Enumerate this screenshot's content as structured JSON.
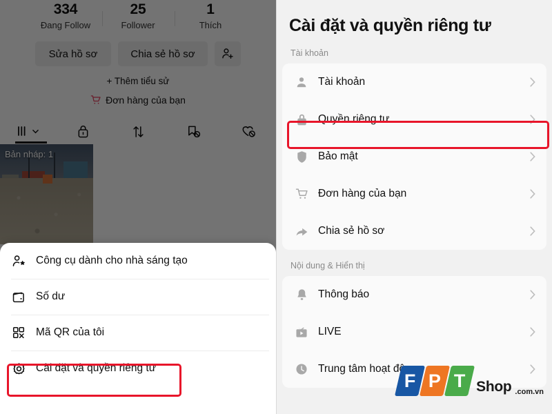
{
  "left_panel": {
    "stats": [
      {
        "value": "334",
        "label": "Đang Follow"
      },
      {
        "value": "25",
        "label": "Follower"
      },
      {
        "value": "1",
        "label": "Thích"
      }
    ],
    "buttons": {
      "edit_profile": "Sửa hồ sơ",
      "share_profile": "Chia sẻ hồ sơ",
      "add_friend_icon": "person-add-icon"
    },
    "add_bio": "+ Thêm tiểu sử",
    "orders_link": "Đơn hàng của bạn",
    "tabs": [
      {
        "icon": "grid-dropdown-icon",
        "name": "tab-posts"
      },
      {
        "icon": "lock-icon",
        "name": "tab-private"
      },
      {
        "icon": "repost-arrows-icon",
        "name": "tab-repost"
      },
      {
        "icon": "bookmark-hidden-icon",
        "name": "tab-saved"
      },
      {
        "icon": "heart-hidden-icon",
        "name": "tab-liked"
      }
    ],
    "draft_badge": "Bản nháp: 1",
    "sheet_items": [
      {
        "icon": "person-star-icon",
        "label": "Công cụ dành cho nhà sáng tạo"
      },
      {
        "icon": "wallet-icon",
        "label": "Số dư"
      },
      {
        "icon": "qr-code-icon",
        "label": "Mã QR của tôi"
      },
      {
        "icon": "gear-icon",
        "label": "Cài đặt và quyền riêng tư"
      }
    ]
  },
  "right_panel": {
    "title": "Cài đặt và quyền riêng tư",
    "sections": [
      {
        "header": "Tài khoản",
        "items": [
          {
            "icon": "person-icon",
            "label": "Tài khoản"
          },
          {
            "icon": "lock-icon",
            "label": "Quyền riêng tư"
          },
          {
            "icon": "shield-icon",
            "label": "Bảo mật"
          },
          {
            "icon": "cart-icon",
            "label": "Đơn hàng của bạn"
          },
          {
            "icon": "share-arrow-icon",
            "label": "Chia sẻ hồ sơ"
          }
        ]
      },
      {
        "header": "Nội dung & Hiển thị",
        "items": [
          {
            "icon": "bell-icon",
            "label": "Thông báo"
          },
          {
            "icon": "live-tv-icon",
            "label": "LIVE"
          },
          {
            "icon": "clock-icon",
            "label": "Trung tâm hoạt động"
          }
        ]
      }
    ]
  },
  "highlights": {
    "color": "#e8152a",
    "left_target": "Cài đặt và quyền riêng tư",
    "right_target": "Quyền riêng tư"
  },
  "watermark": {
    "f": "F",
    "p": "P",
    "t": "T",
    "shop": "Shop",
    "domain": ".com.vn",
    "colors": {
      "f": "#1857a4",
      "p": "#ee7623",
      "t": "#4aab4a"
    }
  }
}
